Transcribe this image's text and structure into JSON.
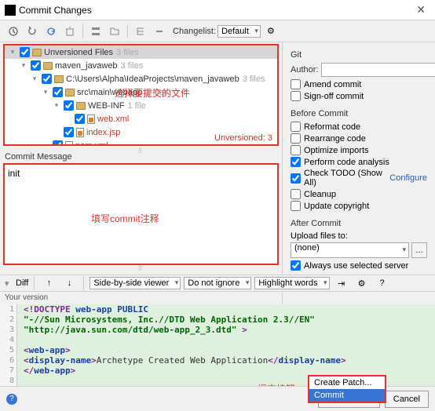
{
  "window": {
    "title": "Commit Changes"
  },
  "toolbar": {
    "changelist_label": "Changelist:",
    "changelist_value": "Default"
  },
  "tree": {
    "root_label": "Unversioned Files",
    "root_count": "3 files",
    "nodes": [
      {
        "indent": 1,
        "label": "maven_javaweb",
        "count": "3 files",
        "type": "folder",
        "red": false
      },
      {
        "indent": 2,
        "label": "C:\\Users\\Alpha\\IdeaProjects\\maven_javaweb",
        "count": "3 files",
        "type": "folder",
        "red": false
      },
      {
        "indent": 3,
        "label": "src\\main\\webapp",
        "count": "2 files",
        "type": "folder",
        "red": false
      },
      {
        "indent": 4,
        "label": "WEB-INF",
        "count": "1 file",
        "type": "folder",
        "red": false
      },
      {
        "indent": 5,
        "label": "web.xml",
        "count": "",
        "type": "file",
        "red": true
      },
      {
        "indent": 4,
        "label": "index.jsp",
        "count": "",
        "type": "file",
        "red": true
      },
      {
        "indent": 3,
        "label": "pom.xml",
        "count": "",
        "type": "file",
        "red": true
      }
    ],
    "unversioned_status": "Unversioned: 3",
    "annot_select": "选择要提交的文件"
  },
  "commit_msg": {
    "label": "Commit Message",
    "value": "init",
    "annot": "填写commit注释"
  },
  "diff": {
    "section": "Diff",
    "viewer": "Side-by-side viewer",
    "ignore": "Do not ignore",
    "highlight": "Highlight words",
    "your_version": "Your version"
  },
  "code_lines": [
    {
      "n": 1,
      "html": "<span class='kw'>&lt;!DOCTYPE</span> <span class='tag'>web-app</span> <span class='tag'>PUBLIC</span>"
    },
    {
      "n": 2,
      "html": " <span class='str'>\"-//Sun Microsystems, Inc.//DTD Web Application 2.3//EN\"</span>"
    },
    {
      "n": 3,
      "html": " <span class='str'>\"http://java.sun.com/dtd/web-app_2_3.dtd\"</span> <span class='kw'>&gt;</span>"
    },
    {
      "n": 4,
      "html": ""
    },
    {
      "n": 5,
      "html": "<span class='kw'>&lt;</span><span class='tag'>web-app</span><span class='kw'>&gt;</span>"
    },
    {
      "n": 6,
      "html": "  <span class='kw'>&lt;</span><span class='tag'>display-name</span><span class='kw'>&gt;</span><span class='txt'>Archetype Created Web Application</span><span class='kw'>&lt;/</span><span class='tag'>display-name</span><span class='kw'>&gt;</span>"
    },
    {
      "n": 7,
      "html": "<span class='kw'>&lt;/</span><span class='tag'>web-app</span><span class='kw'>&gt;</span>"
    },
    {
      "n": 8,
      "html": ""
    }
  ],
  "git": {
    "section": "Git",
    "author_label": "Author:",
    "amend": "Amend commit",
    "signoff": "Sign-off commit"
  },
  "before_commit": {
    "section": "Before Commit",
    "items": [
      {
        "label": "Reformat code",
        "checked": false
      },
      {
        "label": "Rearrange code",
        "checked": false
      },
      {
        "label": "Optimize imports",
        "checked": false
      },
      {
        "label": "Perform code analysis",
        "checked": true
      },
      {
        "label": "Check TODO (Show All)",
        "checked": true,
        "link": "Configure"
      },
      {
        "label": "Cleanup",
        "checked": false
      },
      {
        "label": "Update copyright",
        "checked": false
      }
    ]
  },
  "after_commit": {
    "section": "After Commit",
    "upload_label": "Upload files to:",
    "upload_value": "(none)",
    "always_use": "Always use selected server"
  },
  "dropdown": {
    "create_patch": "Create Patch...",
    "commit": "Commit"
  },
  "buttons": {
    "commit": "Commit",
    "cancel": "Cancel"
  },
  "submit_annot": "提交按钮"
}
